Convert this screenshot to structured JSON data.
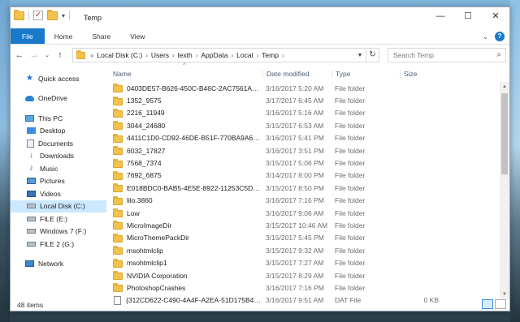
{
  "window": {
    "title": "Temp",
    "controls": {
      "minimize": "—",
      "maximize": "☐",
      "close": "✕"
    }
  },
  "ribbon": {
    "tabs": [
      "File",
      "Home",
      "Share",
      "View"
    ],
    "help": "?"
  },
  "nav": {
    "back": "←",
    "forward": "→",
    "recent": "⌄",
    "up": "↑",
    "breadcrumb": [
      "Local Disk (C:)",
      "Users",
      "lexth",
      "AppData",
      "Local",
      "Temp"
    ],
    "chevron": "«",
    "separator": "›",
    "search_placeholder": "Search Temp"
  },
  "sidebar": {
    "items": [
      {
        "label": "Quick access",
        "icon": "star-icon"
      },
      {
        "label": "OneDrive",
        "icon": "cloud-icon"
      },
      {
        "label": "This PC",
        "icon": "computer-icon"
      },
      {
        "label": "Desktop",
        "icon": "desktop-icon"
      },
      {
        "label": "Documents",
        "icon": "documents-icon"
      },
      {
        "label": "Downloads",
        "icon": "download-icon"
      },
      {
        "label": "Music",
        "icon": "music-icon"
      },
      {
        "label": "Pictures",
        "icon": "pictures-icon"
      },
      {
        "label": "Videos",
        "icon": "videos-icon"
      },
      {
        "label": "Local Disk (C:)",
        "icon": "drive-icon"
      },
      {
        "label": "FILE (E:)",
        "icon": "drive-icon"
      },
      {
        "label": "Windows 7 (F:)",
        "icon": "drive-icon"
      },
      {
        "label": "FILE 2 (G:)",
        "icon": "drive-icon"
      },
      {
        "label": "Network",
        "icon": "network-icon"
      }
    ]
  },
  "columns": {
    "name": "Name",
    "date": "Date modified",
    "type": "Type",
    "size": "Size",
    "sort_indicator": "^"
  },
  "files": [
    {
      "name": "0403DE57-B626-450C-B46C-2AC7561A1D...",
      "date": "3/16/2017 5:20 AM",
      "type": "File folder",
      "size": "",
      "kind": "folder"
    },
    {
      "name": "1352_9575",
      "date": "3/17/2017 6:45 AM",
      "type": "File folder",
      "size": "",
      "kind": "folder"
    },
    {
      "name": "2216_11949",
      "date": "3/16/2017 5:16 AM",
      "type": "File folder",
      "size": "",
      "kind": "folder"
    },
    {
      "name": "3044_24680",
      "date": "3/15/2017 6:53 AM",
      "type": "File folder",
      "size": "",
      "kind": "folder"
    },
    {
      "name": "4411C1D0-CD92-46DE-B51F-770BA9A650...",
      "date": "3/16/2017 5:41 PM",
      "type": "File folder",
      "size": "",
      "kind": "folder"
    },
    {
      "name": "6032_17827",
      "date": "3/16/2017 3:51 PM",
      "type": "File folder",
      "size": "",
      "kind": "folder"
    },
    {
      "name": "7568_7374",
      "date": "3/15/2017 5:06 PM",
      "type": "File folder",
      "size": "",
      "kind": "folder"
    },
    {
      "name": "7692_6875",
      "date": "3/14/2017 8:00 PM",
      "type": "File folder",
      "size": "",
      "kind": "folder"
    },
    {
      "name": "E018BDC0-BAB5-4E5E-8922-11253C5DBD...",
      "date": "3/15/2017 8:50 PM",
      "type": "File folder",
      "size": "",
      "kind": "folder"
    },
    {
      "name": "lilo.3860",
      "date": "3/16/2017 7:16 PM",
      "type": "File folder",
      "size": "",
      "kind": "folder"
    },
    {
      "name": "Low",
      "date": "3/16/2017 9:06 AM",
      "type": "File folder",
      "size": "",
      "kind": "folder"
    },
    {
      "name": "MicroImageDir",
      "date": "3/15/2017 10:46 AM",
      "type": "File folder",
      "size": "",
      "kind": "folder"
    },
    {
      "name": "MicroThemePackDir",
      "date": "3/15/2017 5:45 PM",
      "type": "File folder",
      "size": "",
      "kind": "folder"
    },
    {
      "name": "msohtmlclip",
      "date": "3/15/2017 9:32 AM",
      "type": "File folder",
      "size": "",
      "kind": "folder"
    },
    {
      "name": "msohtmlclip1",
      "date": "3/15/2017 7:27 AM",
      "type": "File folder",
      "size": "",
      "kind": "folder"
    },
    {
      "name": "NVIDIA Corporation",
      "date": "3/15/2017 8:29 AM",
      "type": "File folder",
      "size": "",
      "kind": "folder"
    },
    {
      "name": "PhotoshopCrashes",
      "date": "3/16/2017 7:16 PM",
      "type": "File folder",
      "size": "",
      "kind": "folder"
    },
    {
      "name": "{312CD622-C490-4A4F-A2EA-51D175B42...",
      "date": "3/16/2017 9:51 AM",
      "type": "DAT File",
      "size": "0 KB",
      "kind": "file"
    }
  ],
  "status": {
    "count": "48 items"
  },
  "colors": {
    "accent": "#1979ca",
    "folder": "#f3c24a",
    "selected": "#cce8ff"
  }
}
